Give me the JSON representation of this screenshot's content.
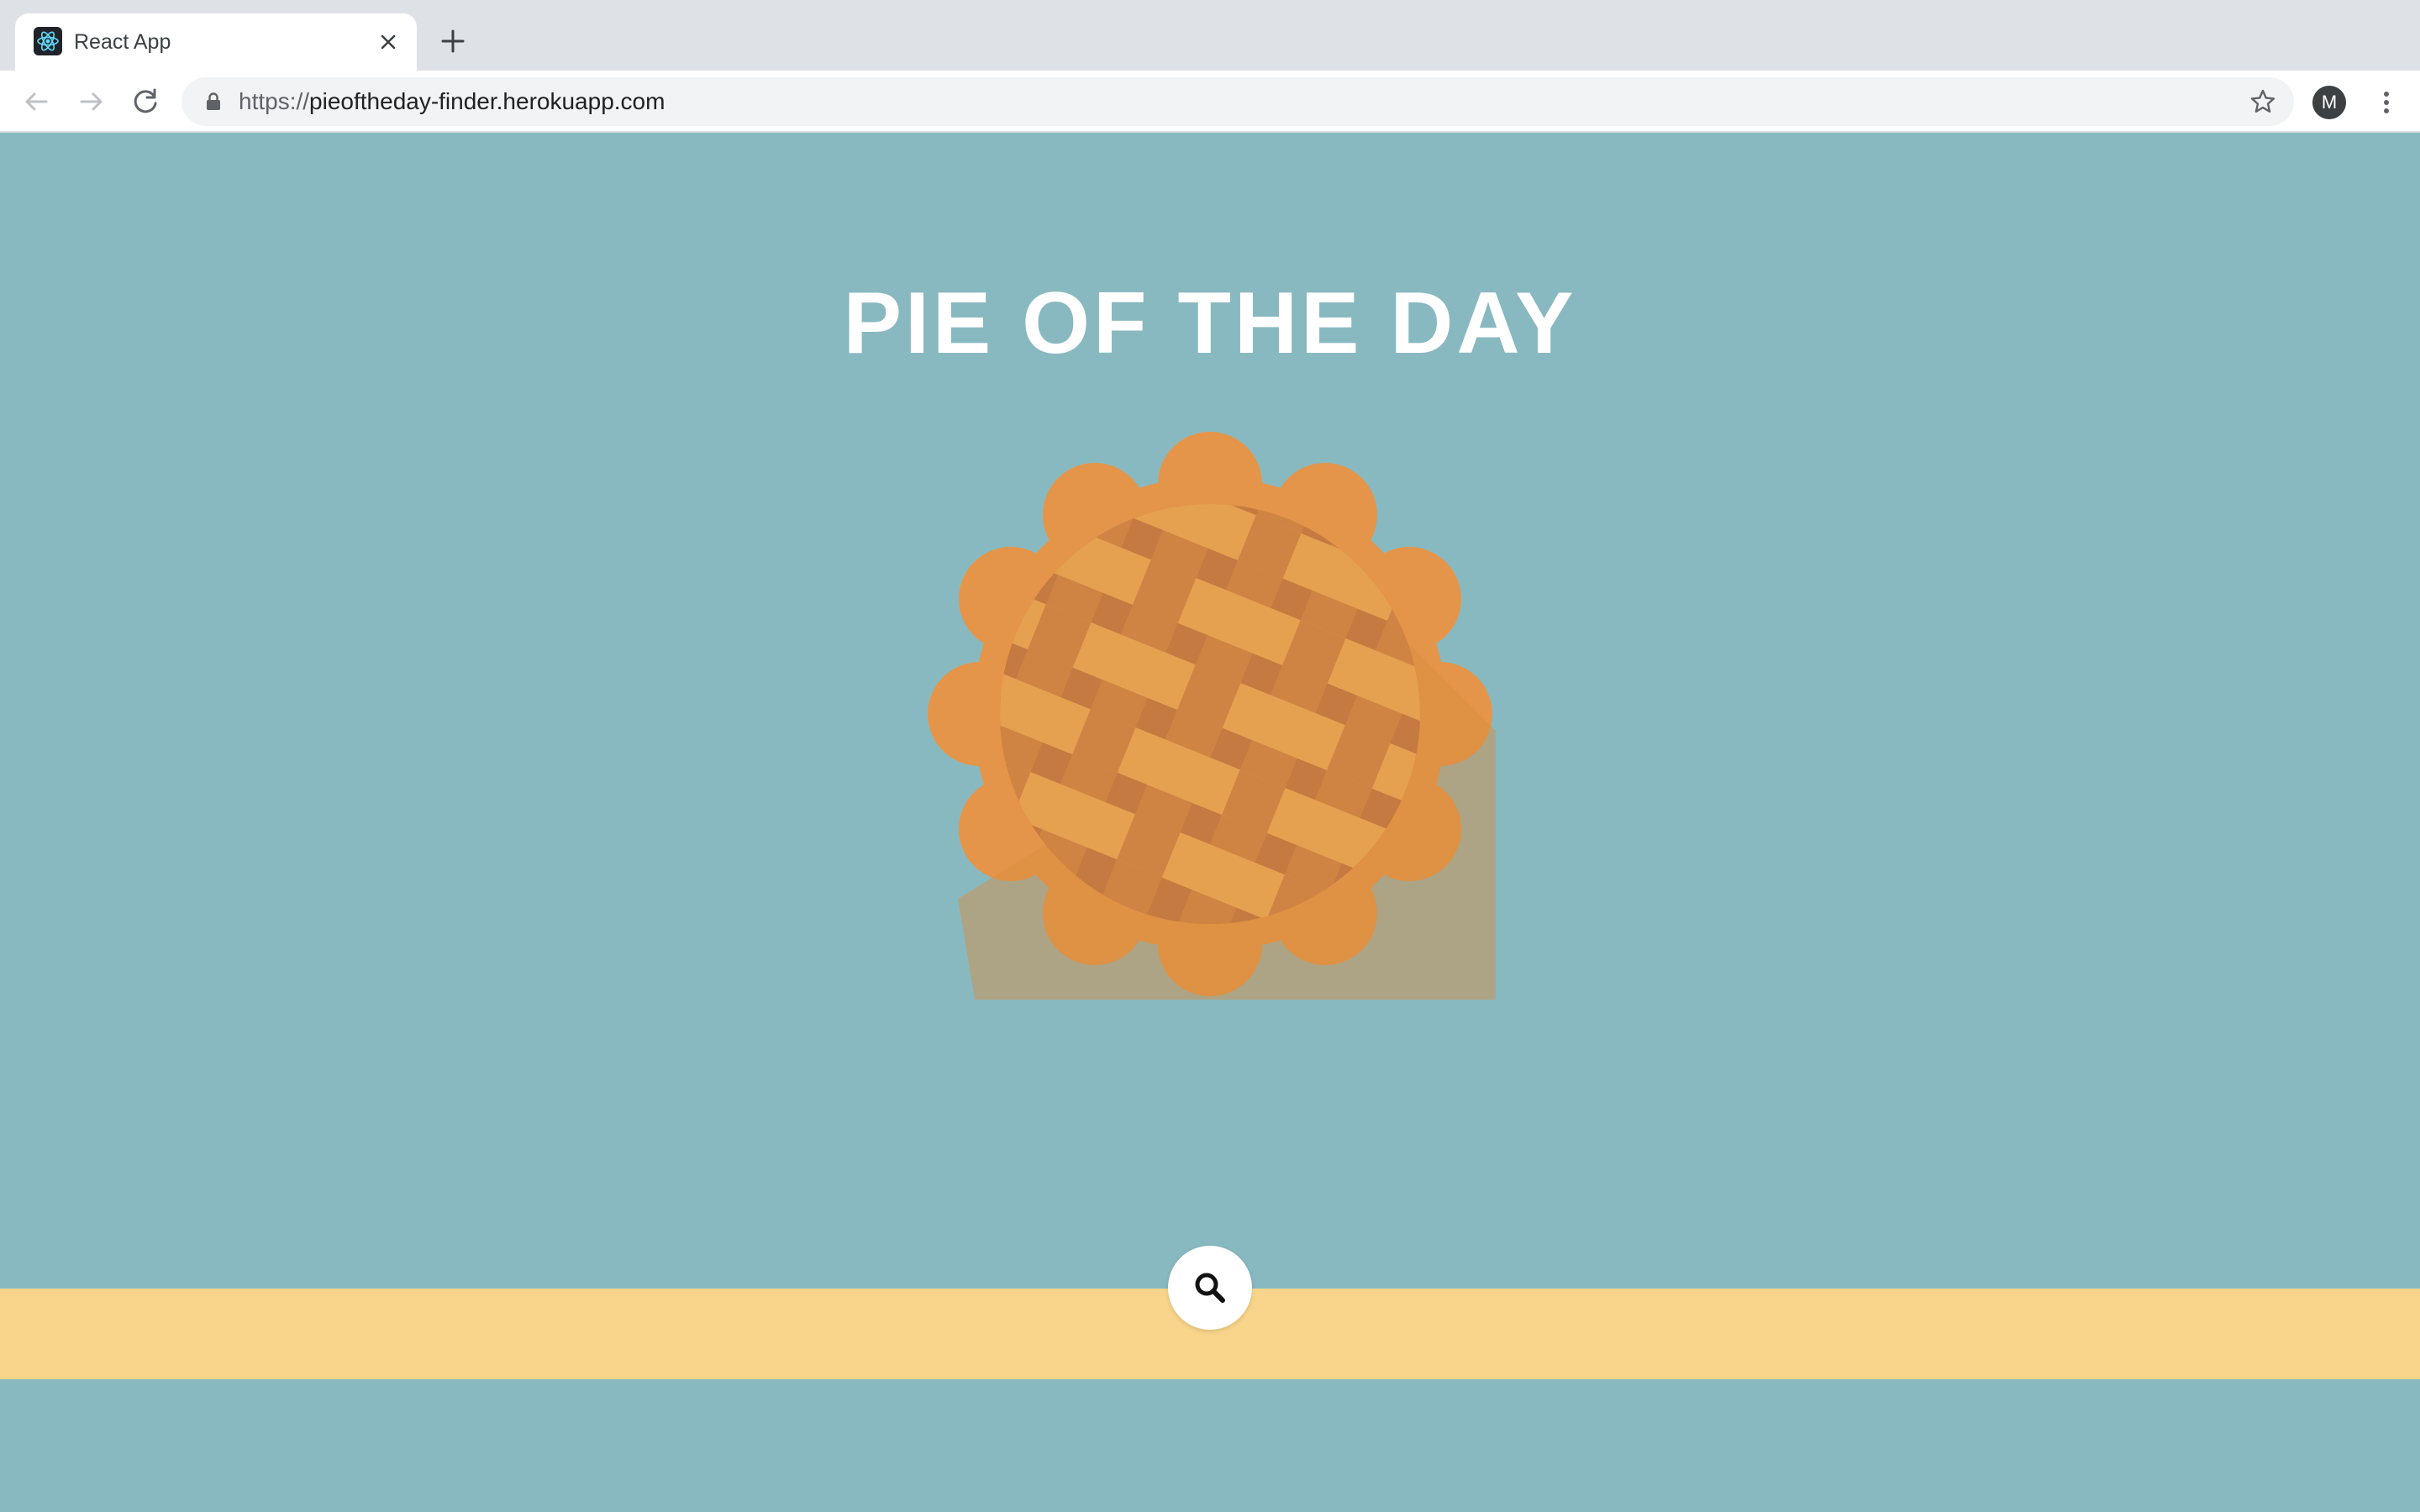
{
  "browser": {
    "tab": {
      "title": "React App",
      "favicon": "react-logo-icon"
    },
    "address_bar": {
      "scheme": "https://",
      "host": "pieoftheday-finder.herokuapp.com"
    },
    "profile_initial": "M"
  },
  "page": {
    "title": "PIE OF THE DAY",
    "illustration": "lattice-pie-icon",
    "search_button_icon": "search-icon",
    "colors": {
      "background": "#89b9c0",
      "footer_band": "#f8d58a",
      "crust": "#e49549",
      "lattice_light": "#e6a150",
      "lattice_dark": "#cf8444",
      "title_text": "#ffffff"
    }
  }
}
